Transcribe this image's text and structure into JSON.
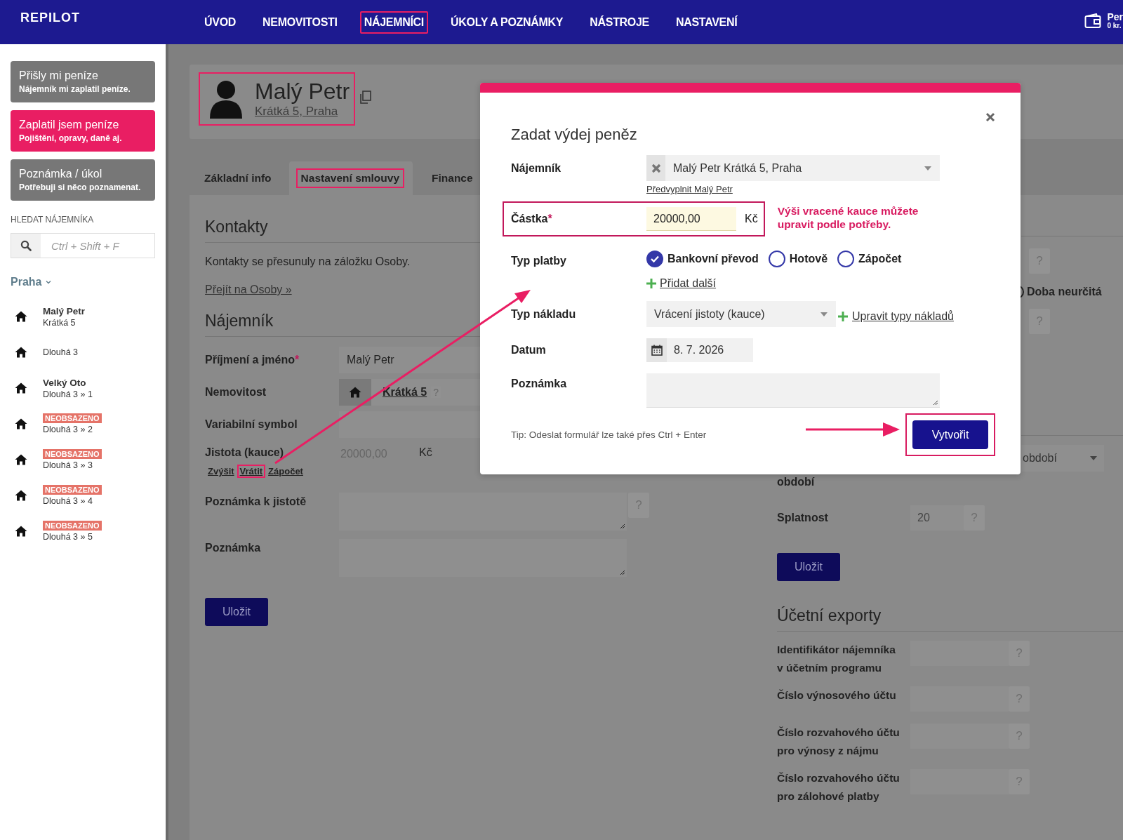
{
  "brand": {
    "logo": "REPILOT"
  },
  "nav": [
    {
      "label": "ÚVOD",
      "highlighted": false
    },
    {
      "label": "NEMOVITOSTI",
      "highlighted": false
    },
    {
      "label": "NÁJEMNÍCI",
      "highlighted": true
    },
    {
      "label": "ÚKOLY A POZNÁMKY",
      "highlighted": false
    },
    {
      "label": "NÁSTROJE",
      "highlighted": false
    },
    {
      "label": "NASTAVENÍ",
      "highlighted": false
    }
  ],
  "account": {
    "name": "Per",
    "balance": "0 kr."
  },
  "sidebar": {
    "actions": [
      {
        "title": "Přišly mi peníze",
        "subtitle": "Nájemník mi zaplatil peníze.",
        "color": "#777777"
      },
      {
        "title": "Zaplatil jsem peníze",
        "subtitle": "Pojištění, opravy, daně aj.",
        "color": "#e91e63"
      },
      {
        "title": "Poznámka / úkol",
        "subtitle": "Potřebuji si něco poznamenat.",
        "color": "#777777"
      }
    ],
    "search": {
      "label": "HLEDAT NÁJEMNÍKA",
      "placeholder": "Ctrl + Shift + F"
    },
    "group": {
      "label": "Praha",
      "expanded": true,
      "items": [
        {
          "name": "Malý Petr",
          "address": "Krátká 5"
        },
        {
          "address": "Dlouhá 3"
        },
        {
          "name": "Velký Oto",
          "address": "Dlouhá 3 » 1"
        },
        {
          "badge": "NEOBSAZENO",
          "address": "Dlouhá 3 » 2"
        },
        {
          "badge": "NEOBSAZENO",
          "address": "Dlouhá 3 » 3"
        },
        {
          "badge": "NEOBSAZENO",
          "address": "Dlouhá 3 » 4"
        },
        {
          "badge": "NEOBSAZENO",
          "address": "Dlouhá 3 » 5"
        }
      ]
    }
  },
  "tenant": {
    "name": "Malý Petr",
    "address": "Krátká 5, Praha",
    "highlighted": true
  },
  "tabs": [
    {
      "label": "Základní info",
      "selected": false,
      "highlighted": false
    },
    {
      "label": "Nastavení smlouvy",
      "selected": true,
      "highlighted": true
    },
    {
      "label": "Finance",
      "selected": false,
      "highlighted": false
    }
  ],
  "contacts": {
    "heading": "Kontakty",
    "text": "Kontakty se přesunuly na záložku Osoby.",
    "link": "Přejít na Osoby »"
  },
  "tenant_form": {
    "heading": "Nájemník",
    "fields": [
      {
        "kind": "text",
        "label": "Příjmení a jméno",
        "required_mark": "*",
        "value": "Malý Petr"
      },
      {
        "kind": "property",
        "label": "Nemovitost",
        "value": "Krátká 5",
        "help": "?"
      },
      {
        "kind": "text",
        "label": "Variabilní symbol"
      },
      {
        "kind": "amount",
        "label": "Jistota (kauce)",
        "value": "20000,00",
        "unit": "Kč",
        "actions": [
          {
            "label": "Zvýšit",
            "highlighted": false
          },
          {
            "label": "Vrátit",
            "highlighted": true
          },
          {
            "label": "Zápočet",
            "highlighted": false
          }
        ]
      },
      {
        "kind": "textarea",
        "label": "Poznámka k jistotě",
        "help": "?"
      },
      {
        "kind": "textarea",
        "label": "Poznámka"
      }
    ],
    "save": "Uložit"
  },
  "contract": {
    "help_marks": [
      "?",
      "?"
    ],
    "term_option": {
      "label": "Doba neurčitá",
      "selected": false
    },
    "period_select": "období",
    "period_label": "období",
    "due_label": "Splatnost",
    "due_value": "20",
    "due_help": "?",
    "save": "Uložit"
  },
  "exports": {
    "heading": "Účetní exporty",
    "fields": [
      {
        "label": "Identifikátor nájemníka v účetním programu",
        "help": "?"
      },
      {
        "label": "Číslo výnosového účtu",
        "help": "?"
      },
      {
        "label": "Číslo rozvahového účtu pro výnosy z nájmu",
        "help": "?"
      },
      {
        "label": "Číslo rozvahového účtu pro zálohové platby",
        "help": "?"
      }
    ]
  },
  "dialog": {
    "title": "Zadat výdej peněz",
    "tenant": {
      "label": "Nájemník",
      "value": "Malý Petr Krátká 5, Praha",
      "prefill_link": "Předvyplnit Malý Petr"
    },
    "amount": {
      "label": "Částka",
      "required_mark": "*",
      "value": "20000,00",
      "unit": "Kč",
      "highlighted": true,
      "hint": "Výši vracené kauce můžete upravit podle potřeby."
    },
    "payment": {
      "label": "Typ platby",
      "options": [
        {
          "label": "Bankovní převod",
          "selected": true
        },
        {
          "label": "Hotově",
          "selected": false
        },
        {
          "label": "Zápočet",
          "selected": false
        }
      ],
      "add_link": "Přidat další"
    },
    "cost_type": {
      "label": "Typ nákladu",
      "value": "Vrácení jistoty (kauce)",
      "edit_link": "Upravit typy nákladů"
    },
    "date": {
      "label": "Datum",
      "value": "8. 7. 2026"
    },
    "note": {
      "label": "Poznámka"
    },
    "tip": "Tip: Odeslat formulář lze také přes Ctrl + Enter",
    "submit": {
      "label": "Vytvořit",
      "highlighted": true
    }
  }
}
